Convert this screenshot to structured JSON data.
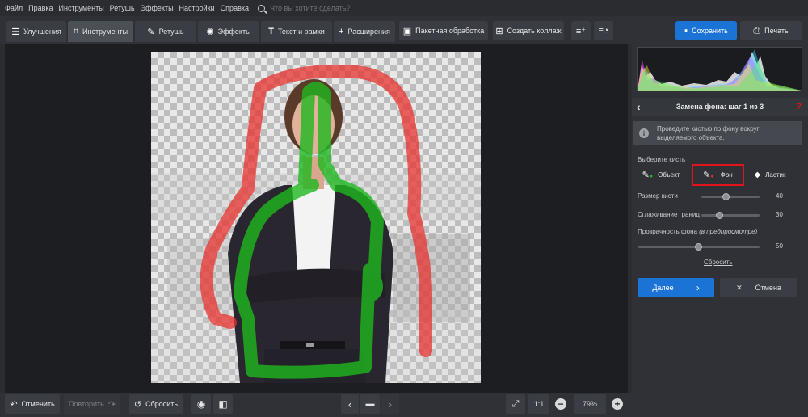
{
  "menu": [
    "Файл",
    "Правка",
    "Инструменты",
    "Ретушь",
    "Эффекты",
    "Настройки",
    "Справка"
  ],
  "search": {
    "placeholder": "Что вы хотите сделать?"
  },
  "tabs": [
    {
      "label": "Улучшения",
      "icon": "sliders-icon"
    },
    {
      "label": "Инструменты",
      "icon": "crop-icon"
    },
    {
      "label": "Ретушь",
      "icon": "brush-icon"
    },
    {
      "label": "Эффекты",
      "icon": "sparkle-icon"
    },
    {
      "label": "Текст и рамки",
      "icon": "text-icon"
    },
    {
      "label": "Расширения",
      "icon": "plus-icon"
    }
  ],
  "toolbar": {
    "batch_label": "Пакетная обработка",
    "collage_label": "Создать коллаж",
    "save_label": "Сохранить",
    "print_label": "Печать"
  },
  "panel": {
    "title": "Замена фона: шаг 1 из 3",
    "help": "?",
    "hint": "Проведите кистью по фону вокруг выделяемого объекта.",
    "choose_brush": "Выберите кисть",
    "brushes": [
      {
        "label": "Объект",
        "icon": "brush-object-icon",
        "selected": false
      },
      {
        "label": "Фон",
        "icon": "brush-background-icon",
        "selected": true
      },
      {
        "label": "Ластик",
        "icon": "eraser-icon",
        "selected": false
      }
    ],
    "brush_size": {
      "label": "Размер кисти",
      "value": 40
    },
    "edge_smoothing": {
      "label": "Сглаживание границ",
      "value": 30
    },
    "bg_opacity": {
      "label": "Прозрачность фона",
      "note": "(в предпросмотре)",
      "value": 50
    },
    "reset_label": "Сбросить",
    "next_label": "Далее",
    "cancel_label": "Отмена"
  },
  "bottom": {
    "undo_label": "Отменить",
    "redo_label": "Повторить",
    "reset_label": "Сбросить",
    "ratio_label": "1:1",
    "zoom": "79%"
  },
  "colors": {
    "accent": "#1c73d6",
    "selected_border": "#e2131b",
    "object_stroke": "#1fb81f",
    "background_stroke": "#e8332f"
  }
}
